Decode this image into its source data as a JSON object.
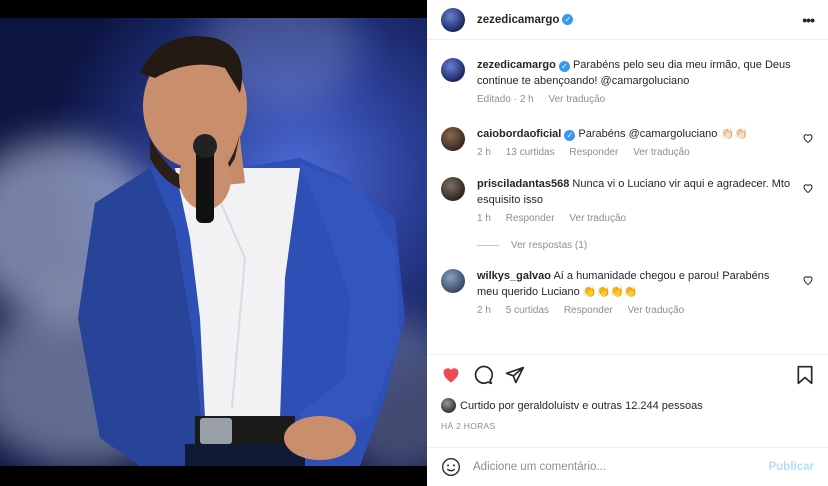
{
  "post": {
    "username": "zezedicamargo",
    "caption_user": "zezedicamargo",
    "caption_text": "Parabéns pelo seu dia meu irmão, que Deus continue te abençoando! @camargoluciano",
    "caption_meta_edited": "Editado",
    "caption_meta_time": "2 h",
    "caption_meta_translate": "Ver tradução"
  },
  "comments": [
    {
      "user": "caioborda​oficial",
      "text": "Parabéns @camargoluciano 👏🏻👏🏻",
      "time": "2 h",
      "likes": "13 curtidas",
      "reply": "Responder",
      "translate": "Ver tradução"
    },
    {
      "user": "prisciladantas568",
      "text": "Nunca vi o Luciano vir aqui e agradecer. Mto esquisito isso",
      "time": "1 h",
      "reply": "Responder",
      "translate": "Ver tradução"
    },
    {
      "user": "wilkys_galvao",
      "text": "Aí a humanidade chegou e parou! Parabéns meu querido Luciano 👏👏👏👏",
      "time": "2 h",
      "likes": "5 curtidas",
      "reply": "Responder",
      "translate": "Ver tradução"
    }
  ],
  "view_replies": "Ver respostas (1)",
  "likes_text": "Curtido por geraldoluistv e outras 12.244 pessoas",
  "time_ago": "HÁ 2 HORAS",
  "comment_placeholder": "Adicione um comentário...",
  "publish_label": "Publicar",
  "colors": {
    "like_red": "#ed4956",
    "verified_blue": "#3897f0",
    "publish_disabled": "#b2dffc"
  }
}
